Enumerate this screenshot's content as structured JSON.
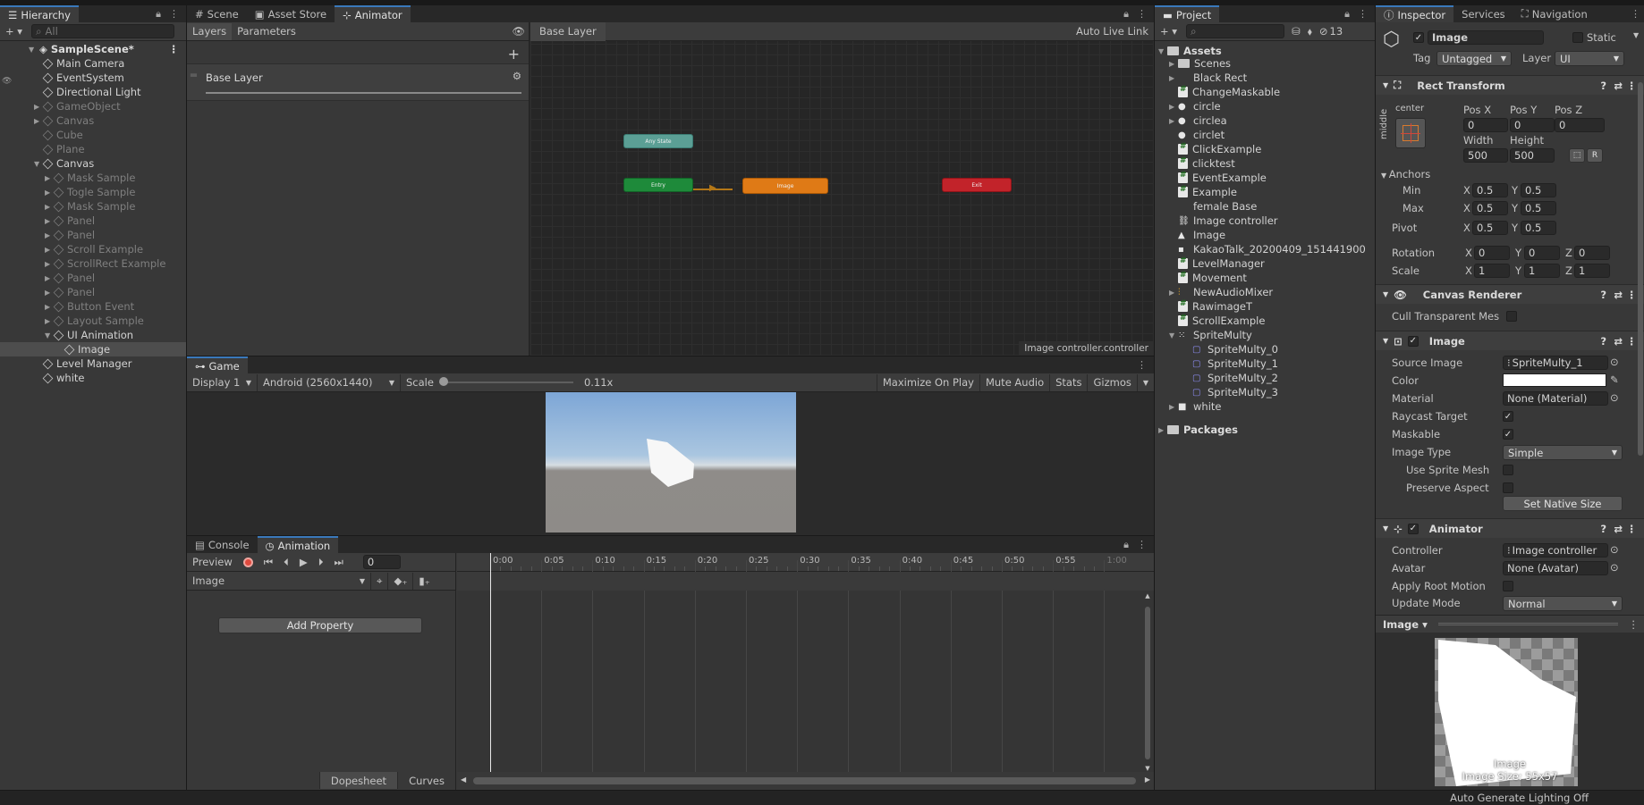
{
  "hierarchy": {
    "tab": "Hierarchy",
    "search_placeholder": "All",
    "scene": "SampleScene*",
    "items": [
      {
        "label": "Main Camera",
        "depth": 1,
        "dim": false,
        "arrow": ""
      },
      {
        "label": "EventSystem",
        "depth": 1,
        "dim": false,
        "arrow": ""
      },
      {
        "label": "Directional Light",
        "depth": 1,
        "dim": false,
        "arrow": ""
      },
      {
        "label": "GameObject",
        "depth": 1,
        "dim": true,
        "arrow": "▶"
      },
      {
        "label": "Canvas",
        "depth": 1,
        "dim": true,
        "arrow": "▶"
      },
      {
        "label": "Cube",
        "depth": 1,
        "dim": true,
        "arrow": ""
      },
      {
        "label": "Plane",
        "depth": 1,
        "dim": true,
        "arrow": ""
      },
      {
        "label": "Canvas",
        "depth": 1,
        "dim": false,
        "arrow": "▼"
      },
      {
        "label": "Mask Sample",
        "depth": 2,
        "dim": true,
        "arrow": "▶"
      },
      {
        "label": "Togle Sample",
        "depth": 2,
        "dim": true,
        "arrow": "▶"
      },
      {
        "label": "Mask Sample",
        "depth": 2,
        "dim": true,
        "arrow": "▶"
      },
      {
        "label": "Panel",
        "depth": 2,
        "dim": true,
        "arrow": "▶"
      },
      {
        "label": "Panel",
        "depth": 2,
        "dim": true,
        "arrow": "▶"
      },
      {
        "label": "Scroll Example",
        "depth": 2,
        "dim": true,
        "arrow": "▶"
      },
      {
        "label": "ScrollRect Example",
        "depth": 2,
        "dim": true,
        "arrow": "▶"
      },
      {
        "label": "Panel",
        "depth": 2,
        "dim": true,
        "arrow": "▶"
      },
      {
        "label": "Panel",
        "depth": 2,
        "dim": true,
        "arrow": "▶"
      },
      {
        "label": "Button Event",
        "depth": 2,
        "dim": true,
        "arrow": "▶"
      },
      {
        "label": "Layout Sample",
        "depth": 2,
        "dim": true,
        "arrow": "▶"
      },
      {
        "label": "UI Animation",
        "depth": 2,
        "dim": false,
        "arrow": "▼"
      },
      {
        "label": "Image",
        "depth": 3,
        "dim": false,
        "arrow": "",
        "selected": true
      },
      {
        "label": "Level Manager",
        "depth": 1,
        "dim": false,
        "arrow": ""
      },
      {
        "label": "white",
        "depth": 1,
        "dim": false,
        "arrow": ""
      }
    ]
  },
  "center_tabs": {
    "scene": "Scene",
    "asset_store": "Asset Store",
    "animator": "Animator"
  },
  "animator": {
    "layers_tab": "Layers",
    "parameters_tab": "Parameters",
    "breadcrumb": "Base Layer",
    "auto_live_link": "Auto Live Link",
    "layer_name": "Base Layer",
    "node_any": "Any State",
    "node_entry": "Entry",
    "node_image": "Image",
    "node_exit": "Exit",
    "status": "Image controller.controller"
  },
  "game": {
    "tab": "Game",
    "display": "Display 1",
    "resolution": "Android (2560x1440)",
    "scale_label": "Scale",
    "scale_value": "0.11x",
    "maximize": "Maximize On Play",
    "mute": "Mute Audio",
    "stats": "Stats",
    "gizmos": "Gizmos"
  },
  "animation": {
    "console_tab": "Console",
    "animation_tab": "Animation",
    "preview": "Preview",
    "frame": "0",
    "clip": "Image",
    "add_property": "Add Property",
    "ticks": [
      "0:00",
      "0:05",
      "0:10",
      "0:15",
      "0:20",
      "0:25",
      "0:30",
      "0:35",
      "0:40",
      "0:45",
      "0:50",
      "0:55",
      "1:00"
    ],
    "dopesheet": "Dopesheet",
    "curves": "Curves"
  },
  "project": {
    "tab": "Project",
    "badge": "13",
    "assets": "Assets",
    "packages": "Packages",
    "items": [
      {
        "label": "Scenes",
        "icon": "folder",
        "arrow": "▶"
      },
      {
        "label": "Black Rect",
        "icon": "none",
        "arrow": "▶"
      },
      {
        "label": "ChangeMaskable",
        "icon": "script",
        "arrow": ""
      },
      {
        "label": "circle",
        "icon": "sprite",
        "arrow": "▶"
      },
      {
        "label": "circlea",
        "icon": "sprite",
        "arrow": "▶"
      },
      {
        "label": "circlet",
        "icon": "sprite",
        "arrow": ""
      },
      {
        "label": "ClickExample",
        "icon": "script",
        "arrow": ""
      },
      {
        "label": "clicktest",
        "icon": "script",
        "arrow": ""
      },
      {
        "label": "EventExample",
        "icon": "script",
        "arrow": ""
      },
      {
        "label": "Example",
        "icon": "script",
        "arrow": ""
      },
      {
        "label": "female Base",
        "icon": "none",
        "arrow": ""
      },
      {
        "label": "Image controller",
        "icon": "controller",
        "arrow": ""
      },
      {
        "label": "Image",
        "icon": "anim",
        "arrow": ""
      },
      {
        "label": "KakaoTalk_20200409_151441900",
        "icon": "image",
        "arrow": ""
      },
      {
        "label": "LevelManager",
        "icon": "script",
        "arrow": ""
      },
      {
        "label": "Movement",
        "icon": "script",
        "arrow": ""
      },
      {
        "label": "NewAudioMixer",
        "icon": "mixer",
        "arrow": "▶"
      },
      {
        "label": "RawimageT",
        "icon": "script",
        "arrow": ""
      },
      {
        "label": "ScrollExample",
        "icon": "script",
        "arrow": ""
      },
      {
        "label": "SpriteMulty",
        "icon": "spritemulti",
        "arrow": "▼"
      },
      {
        "label": "SpriteMulty_0",
        "icon": "sub",
        "arrow": ""
      },
      {
        "label": "SpriteMulty_1",
        "icon": "sub",
        "arrow": ""
      },
      {
        "label": "SpriteMulty_2",
        "icon": "sub",
        "arrow": ""
      },
      {
        "label": "SpriteMulty_3",
        "icon": "sub",
        "arrow": ""
      },
      {
        "label": "white",
        "icon": "white",
        "arrow": "▶"
      }
    ]
  },
  "inspector": {
    "tab": "Inspector",
    "services_tab": "Services",
    "navigation_tab": "Navigation",
    "object_name": "Image",
    "static": "Static",
    "tag_label": "Tag",
    "tag_value": "Untagged",
    "layer_label": "Layer",
    "layer_value": "UI",
    "rect_transform": "Rect Transform",
    "center": "center",
    "middle": "middle",
    "pos_x_label": "Pos X",
    "pos_y_label": "Pos Y",
    "pos_z_label": "Pos Z",
    "pos_x": "0",
    "pos_y": "0",
    "pos_z": "0",
    "width_label": "Width",
    "height_label": "Height",
    "width": "500",
    "height": "500",
    "anchors": "Anchors",
    "min_label": "Min",
    "max_label": "Max",
    "pivot_label": "Pivot",
    "min_x": "0.5",
    "min_y": "0.5",
    "max_x": "0.5",
    "max_y": "0.5",
    "pivot_x": "0.5",
    "pivot_y": "0.5",
    "rotation_label": "Rotation",
    "rot_x": "0",
    "rot_y": "0",
    "rot_z": "0",
    "scale_label": "Scale",
    "scale_x": "1",
    "scale_y": "1",
    "scale_z": "1",
    "canvas_renderer": "Canvas Renderer",
    "cull_transparent": "Cull Transparent Mes",
    "image_comp": "Image",
    "source_image_label": "Source Image",
    "source_image": "SpriteMulty_1",
    "color_label": "Color",
    "material_label": "Material",
    "material": "None (Material)",
    "raycast_label": "Raycast Target",
    "maskable_label": "Maskable",
    "image_type_label": "Image Type",
    "image_type": "Simple",
    "use_sprite_mesh": "Use Sprite Mesh",
    "preserve_aspect": "Preserve Aspect",
    "set_native": "Set Native Size",
    "animator_comp": "Animator",
    "controller_label": "Controller",
    "controller": "Image controller",
    "avatar_label": "Avatar",
    "avatar": "None (Avatar)",
    "apply_root": "Apply Root Motion",
    "update_mode_label": "Update Mode",
    "update_mode": "Normal",
    "preview_title": "Image",
    "preview_caption": "Image",
    "preview_size": "Image Size: 55x57"
  },
  "status_bar": "Auto Generate Lighting Off"
}
